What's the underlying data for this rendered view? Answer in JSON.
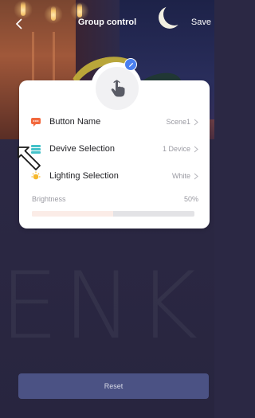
{
  "header": {
    "title": "Group control",
    "save_label": "Save",
    "back_icon": "chevron-left-icon"
  },
  "avatar": {
    "icon": "hand-pointer-icon",
    "edit_icon": "pencil-icon"
  },
  "settings": {
    "items": [
      {
        "label": "Button Name",
        "value": "Scene1",
        "icon": "chat-bubble-icon",
        "icon_color": "#f2683d"
      },
      {
        "label": "Devive Selection",
        "value": "1 Device",
        "icon": "device-list-icon",
        "icon_color": "#44c2c9"
      },
      {
        "label": "Lighting Selection",
        "value": "White",
        "icon": "sun-icon",
        "icon_color": "#f6b72a"
      }
    ]
  },
  "brightness": {
    "label": "Brightness",
    "value_text": "50%",
    "level": 0.5
  },
  "watermark": "ENK",
  "footer": {
    "reset_label": "Reset"
  },
  "colors": {
    "accent_blue": "#4a7ff0",
    "reset_button": "#4b5284",
    "background": "#2b2844"
  }
}
